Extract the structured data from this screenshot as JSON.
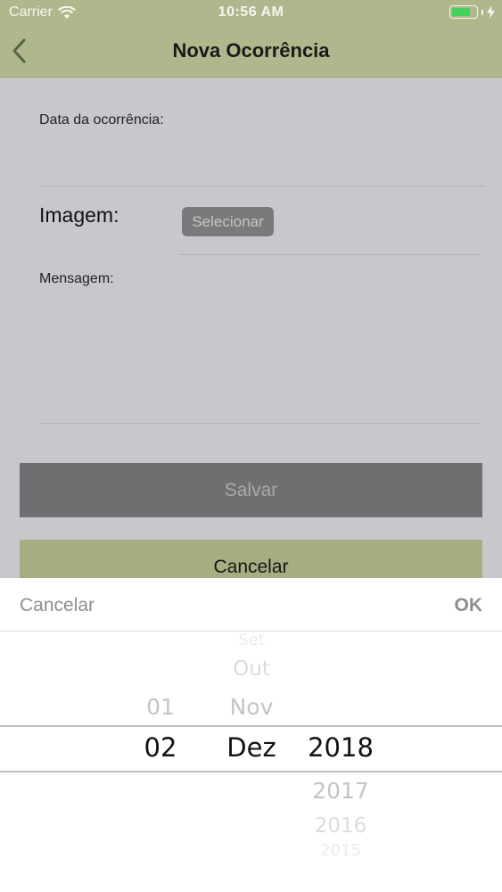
{
  "status_bar": {
    "carrier": "Carrier",
    "time": "10:56 AM",
    "battery_level": 0.8,
    "battery_color": "#43d15a"
  },
  "nav": {
    "title": "Nova Ocorrência",
    "back_icon": "chevron-left-icon"
  },
  "form": {
    "date_label": "Data da ocorrência:",
    "image_label": "Imagem:",
    "select_button": "Selecionar",
    "message_label": "Mensagem:",
    "save_button": "Salvar",
    "cancel_button": "Cancelar"
  },
  "picker": {
    "cancel": "Cancelar",
    "ok": "OK",
    "day": {
      "above": [
        "01"
      ],
      "selected": "02",
      "below": []
    },
    "month": {
      "above": [
        "Set",
        "Out",
        "Nov"
      ],
      "selected": "Dez",
      "below": []
    },
    "year": {
      "above": [],
      "selected": "2018",
      "below": [
        "2017",
        "2016",
        "2015"
      ]
    }
  },
  "colors": {
    "nav_bar": "#aeb88c",
    "accent_button": "#a6ad80",
    "disabled_button": "#6f6f72",
    "overlay": "#c8c7cc"
  }
}
